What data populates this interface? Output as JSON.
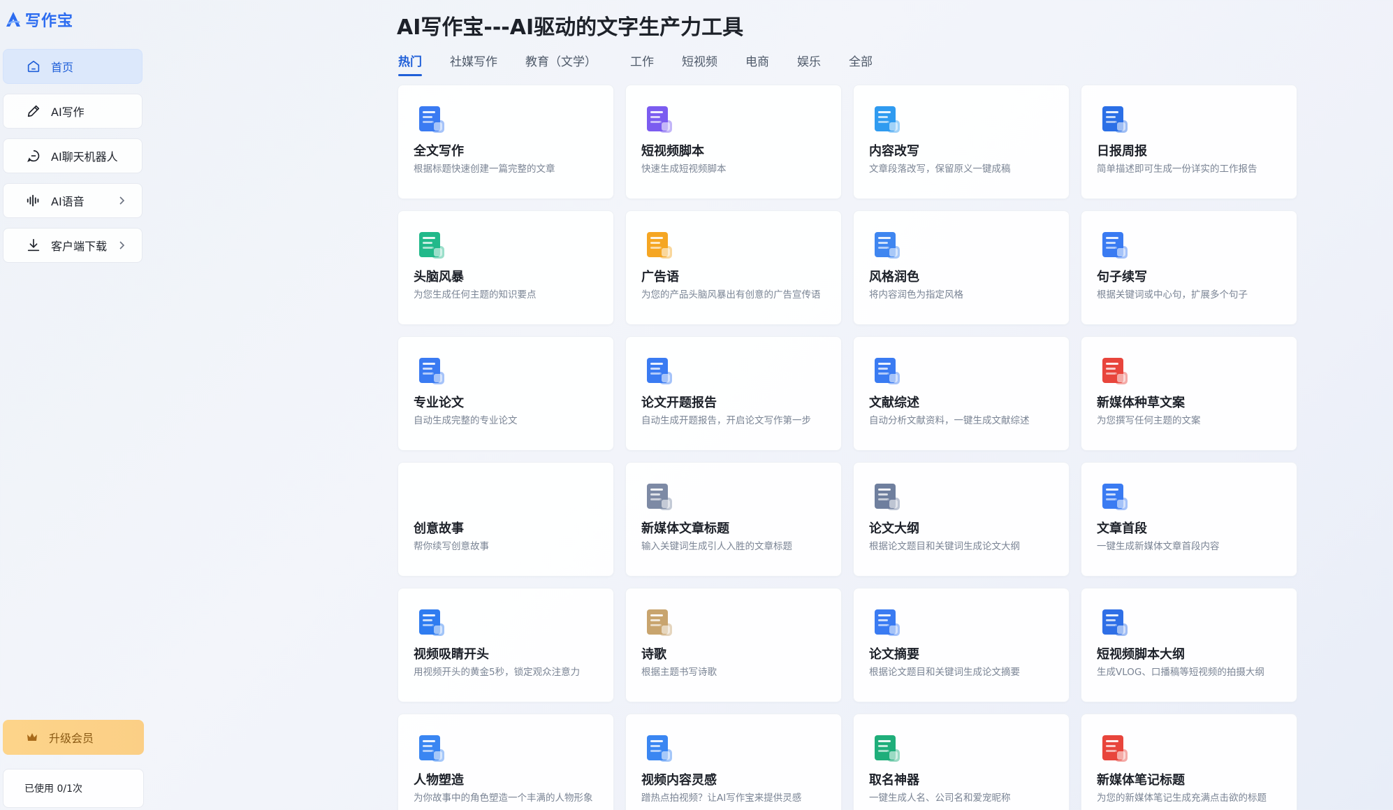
{
  "app": {
    "logo_text": "写作宝"
  },
  "sidebar": {
    "items": [
      {
        "label": "首页",
        "icon": "home-icon",
        "active": true
      },
      {
        "label": "AI写作",
        "icon": "pen-icon"
      },
      {
        "label": "AI聊天机器人",
        "icon": "chat-icon"
      },
      {
        "label": "AI语音",
        "icon": "audio-wave-icon",
        "has_arrow": true
      },
      {
        "label": "客户端下载",
        "icon": "download-icon",
        "has_arrow": true
      }
    ],
    "upgrade_label": "升级会员",
    "usage_text": "已使用 0/1次"
  },
  "main": {
    "title": "AI写作宝---AI驱动的文字生产力工具",
    "tabs": [
      "热门",
      "社媒写作",
      "教育（文学）",
      "工作",
      "短视频",
      "电商",
      "娱乐",
      "全部"
    ],
    "active_tab": 0,
    "cards": [
      {
        "title": "全文写作",
        "desc": "根据标题快速创建一篇完整的文章",
        "icon": "document-icon",
        "color": "#3a7bf2"
      },
      {
        "title": "短视频脚本",
        "desc": "快速生成短视频脚本",
        "icon": "video-play-icon",
        "color": "#7b5cf0"
      },
      {
        "title": "内容改写",
        "desc": "文章段落改写，保留原义一键成稿",
        "icon": "rewrite-icon",
        "color": "#2f9bf0"
      },
      {
        "title": "日报周报",
        "desc": "简单描述即可生成一份详实的工作报告",
        "icon": "report-icon",
        "color": "#2b6fe6"
      },
      {
        "title": "头脑风暴",
        "desc": "为您生成任何主题的知识要点",
        "icon": "mindmap-icon",
        "color": "#21b98a"
      },
      {
        "title": "广告语",
        "desc": "为您的产品头脑风暴出有创意的广告宣传语",
        "icon": "ad-icon",
        "color": "#f5a623"
      },
      {
        "title": "风格润色",
        "desc": "将内容润色为指定风格",
        "icon": "folder-icon",
        "color": "#3f86f0"
      },
      {
        "title": "句子续写",
        "desc": "根据关键词或中心句，扩展多个句子",
        "icon": "sentence-icon",
        "color": "#3a7bf2"
      },
      {
        "title": "专业论文",
        "desc": "自动生成完整的专业论文",
        "icon": "paper-icon",
        "color": "#3a7bf2"
      },
      {
        "title": "论文开题报告",
        "desc": "自动生成开题报告，开启论文写作第一步",
        "icon": "proposal-icon",
        "color": "#3a7bf2"
      },
      {
        "title": "文献综述",
        "desc": "自动分析文献资料，一键生成文献综述",
        "icon": "literature-icon",
        "color": "#3a7bf2"
      },
      {
        "title": "新媒体种草文案",
        "desc": "为您撰写任何主题的文案",
        "icon": "book-icon",
        "color": "#e8453c"
      },
      {
        "title": "创意故事",
        "desc": "帮你续写创意故事",
        "icon": "",
        "color": ""
      },
      {
        "title": "新媒体文章标题",
        "desc": "输入关键词生成引人入胜的文章标题",
        "icon": "headline-icon",
        "color": "#7d8aa5"
      },
      {
        "title": "论文大纲",
        "desc": "根据论文题目和关键词生成论文大纲",
        "icon": "outline-icon",
        "color": "#6f7f9e"
      },
      {
        "title": "文章首段",
        "desc": "一键生成新媒体文章首段内容",
        "icon": "paragraph-icon",
        "color": "#3a7bf2"
      },
      {
        "title": "视频吸睛开头",
        "desc": "用视频开头的黄金5秒，锁定观众注意力",
        "icon": "clapper-icon",
        "color": "#2f7cf0"
      },
      {
        "title": "诗歌",
        "desc": "根据主题书写诗歌",
        "icon": "poem-icon",
        "color": "#c8a46e"
      },
      {
        "title": "论文摘要",
        "desc": "根据论文题目和关键词生成论文摘要",
        "icon": "abstract-icon",
        "color": "#3a7bf2"
      },
      {
        "title": "短视频脚本大纲",
        "desc": "生成VLOG、口播稿等短视频的拍摄大纲",
        "icon": "code-icon",
        "color": "#2f6fe6"
      },
      {
        "title": "人物塑造",
        "desc": "为你故事中的角色塑造一个丰满的人物形象",
        "icon": "people-icon",
        "color": "#3a86f2"
      },
      {
        "title": "视频内容灵感",
        "desc": "蹭热点拍视频？让AI写作宝来提供灵感",
        "icon": "idea-video-icon",
        "color": "#3a86f2"
      },
      {
        "title": "取名神器",
        "desc": "一键生成人名、公司名和爱宠昵称",
        "icon": "naming-icon",
        "color": "#1fae7a"
      },
      {
        "title": "新媒体笔记标题",
        "desc": "为您的新媒体笔记生成充满点击欲的标题",
        "icon": "note-tag-icon",
        "color": "#e8453c"
      }
    ]
  }
}
